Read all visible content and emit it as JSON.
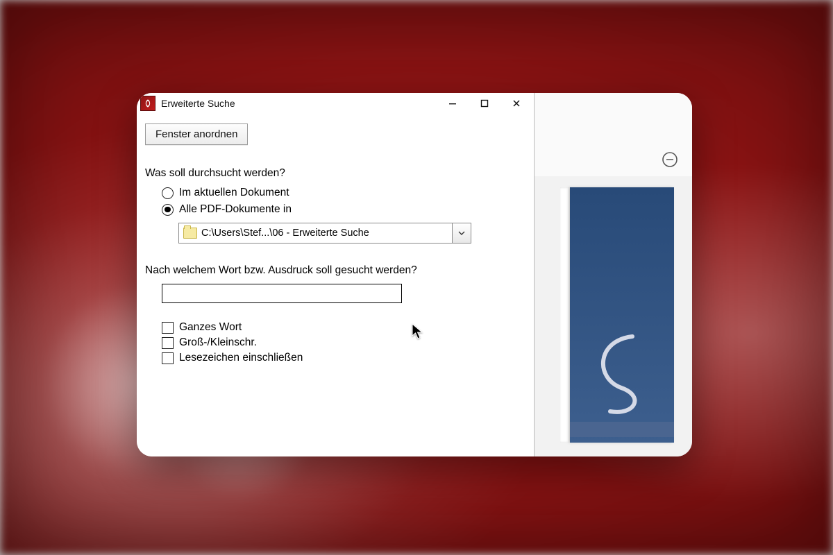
{
  "window": {
    "title": "Erweiterte Suche"
  },
  "toolbar": {
    "arrange_label": "Fenster anordnen"
  },
  "search_scope": {
    "label": "Was soll durchsucht werden?",
    "options": {
      "current_doc": "Im aktuellen Dokument",
      "all_pdfs": "Alle PDF-Dokumente in"
    },
    "selected": "all_pdfs",
    "path_display": "C:\\Users\\Stef...\\06 - Erweiterte Suche"
  },
  "search_term": {
    "label": "Nach welchem Wort bzw. Ausdruck soll gesucht werden?",
    "value": ""
  },
  "options": {
    "whole_word": "Ganzes Wort",
    "case_sensitive": "Groß-/Kleinschr.",
    "include_bookmarks": "Lesezeichen einschließen"
  }
}
